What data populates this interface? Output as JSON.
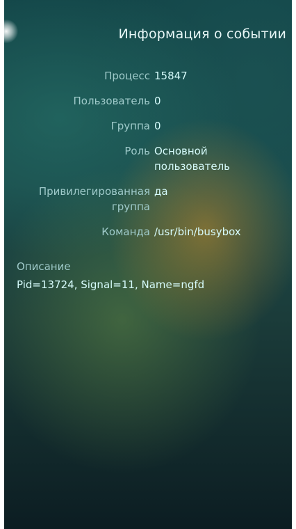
{
  "header": {
    "title": "Информация о событии"
  },
  "details": [
    {
      "label": "Процесс",
      "value": "15847"
    },
    {
      "label": "Пользователь",
      "value": "0"
    },
    {
      "label": "Группа",
      "value": "0"
    },
    {
      "label": "Роль",
      "value": "Основной пользователь"
    },
    {
      "label": "Привилегированная группа",
      "value": "да"
    },
    {
      "label": "Команда",
      "value": "/usr/bin/busybox"
    }
  ],
  "description": {
    "label": "Описание",
    "value": "Pid=13724, Signal=11, Name=ngfd"
  }
}
